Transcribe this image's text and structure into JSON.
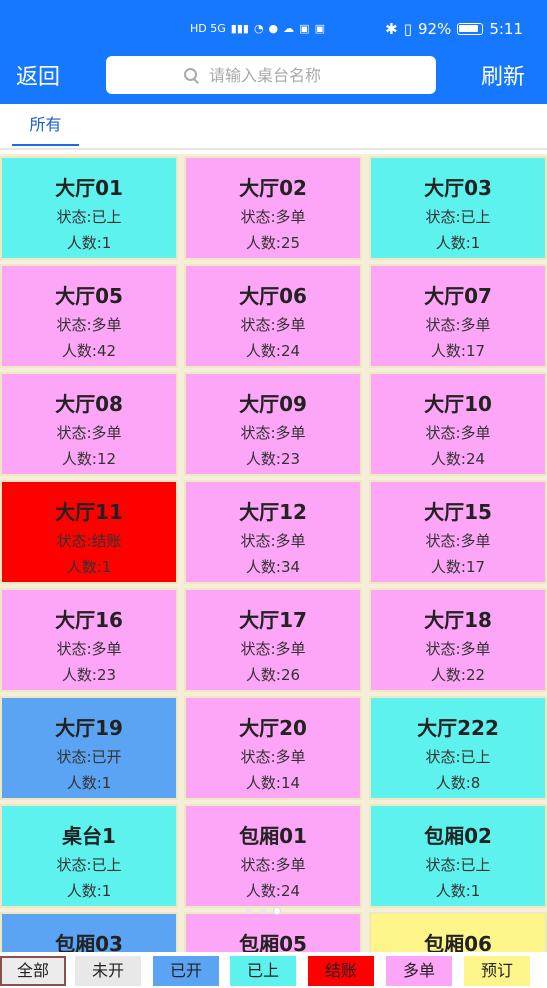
{
  "status_bar": {
    "network": "HD 5G",
    "battery": "92%",
    "time": "5:11"
  },
  "nav": {
    "back_label": "返回",
    "refresh_label": "刷新",
    "search_placeholder": "请输入桌台名称"
  },
  "tabs": [
    {
      "label": "所有"
    }
  ],
  "colors": {
    "accent": "#1677ff",
    "未开": "#e8e8e8",
    "已开": "#5ba4f3",
    "已上": "#5ef2ef",
    "结账": "#ff0000",
    "多单": "#fda5f7",
    "预订": "#fef58a"
  },
  "tables": [
    {
      "name": "大厅01",
      "status": "状态:已上",
      "people": "人数:1",
      "color": "#5ef2ef"
    },
    {
      "name": "大厅02",
      "status": "状态:多单",
      "people": "人数:25",
      "color": "#fda5f7"
    },
    {
      "name": "大厅03",
      "status": "状态:已上",
      "people": "人数:1",
      "color": "#5ef2ef"
    },
    {
      "name": "大厅05",
      "status": "状态:多单",
      "people": "人数:42",
      "color": "#fda5f7"
    },
    {
      "name": "大厅06",
      "status": "状态:多单",
      "people": "人数:24",
      "color": "#fda5f7"
    },
    {
      "name": "大厅07",
      "status": "状态:多单",
      "people": "人数:17",
      "color": "#fda5f7"
    },
    {
      "name": "大厅08",
      "status": "状态:多单",
      "people": "人数:12",
      "color": "#fda5f7"
    },
    {
      "name": "大厅09",
      "status": "状态:多单",
      "people": "人数:23",
      "color": "#fda5f7"
    },
    {
      "name": "大厅10",
      "status": "状态:多单",
      "people": "人数:24",
      "color": "#fda5f7"
    },
    {
      "name": "大厅11",
      "status": "状态:结账",
      "people": "人数:1",
      "color": "#ff0000"
    },
    {
      "name": "大厅12",
      "status": "状态:多单",
      "people": "人数:34",
      "color": "#fda5f7"
    },
    {
      "name": "大厅15",
      "status": "状态:多单",
      "people": "人数:17",
      "color": "#fda5f7"
    },
    {
      "name": "大厅16",
      "status": "状态:多单",
      "people": "人数:23",
      "color": "#fda5f7"
    },
    {
      "name": "大厅17",
      "status": "状态:多单",
      "people": "人数:26",
      "color": "#fda5f7"
    },
    {
      "name": "大厅18",
      "status": "状态:多单",
      "people": "人数:22",
      "color": "#fda5f7"
    },
    {
      "name": "大厅19",
      "status": "状态:已开",
      "people": "人数:1",
      "color": "#5ba4f3"
    },
    {
      "name": "大厅20",
      "status": "状态:多单",
      "people": "人数:14",
      "color": "#fda5f7"
    },
    {
      "name": "大厅222",
      "status": "状态:已上",
      "people": "人数:8",
      "color": "#5ef2ef"
    },
    {
      "name": "桌台1",
      "status": "状态:已上",
      "people": "人数:1",
      "color": "#5ef2ef"
    },
    {
      "name": "包厢01",
      "status": "状态:多单",
      "people": "人数:24",
      "color": "#fda5f7"
    },
    {
      "name": "包厢02",
      "status": "状态:已上",
      "people": "人数:1",
      "color": "#5ef2ef"
    },
    {
      "name": "包厢03",
      "status": "",
      "people": "",
      "color": "#5ba4f3"
    },
    {
      "name": "包厢05",
      "status": "",
      "people": "",
      "color": "#fda5f7"
    },
    {
      "name": "包厢06",
      "status": "",
      "people": "",
      "color": "#fef58a"
    }
  ],
  "legend": [
    {
      "label": "全部",
      "color": "#ececec"
    },
    {
      "label": "未开",
      "color": "#e8e8e8"
    },
    {
      "label": "已开",
      "color": "#5ba4f3"
    },
    {
      "label": "已上",
      "color": "#5ef2ef"
    },
    {
      "label": "结账",
      "color": "#ff0000"
    },
    {
      "label": "多单",
      "color": "#fda5f7"
    },
    {
      "label": "预订",
      "color": "#fef58a"
    }
  ]
}
